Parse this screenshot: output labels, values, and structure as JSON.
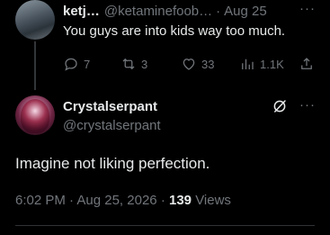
{
  "parent_tweet": {
    "display_name": "ketj…",
    "handle": "@ketaminefoob…",
    "separator": "·",
    "time": "Aug 25",
    "more": "···",
    "text": "You guys are into kids way too much.",
    "actions": {
      "replies": "7",
      "reposts": "3",
      "likes": "33",
      "views": "1.1K"
    }
  },
  "main_tweet": {
    "display_name": "Crystalserpant",
    "handle": "@crystalserpant",
    "more": "···",
    "text": "Imagine not liking perfection.",
    "time": "6:02 PM",
    "date": "Aug 25, 2026",
    "separator": "·",
    "views_count": "139",
    "views_label": "Views"
  },
  "colors": {
    "background": "#000000",
    "text_primary": "#e7e9ea",
    "text_secondary": "#71767b",
    "divider": "#2f3336"
  }
}
